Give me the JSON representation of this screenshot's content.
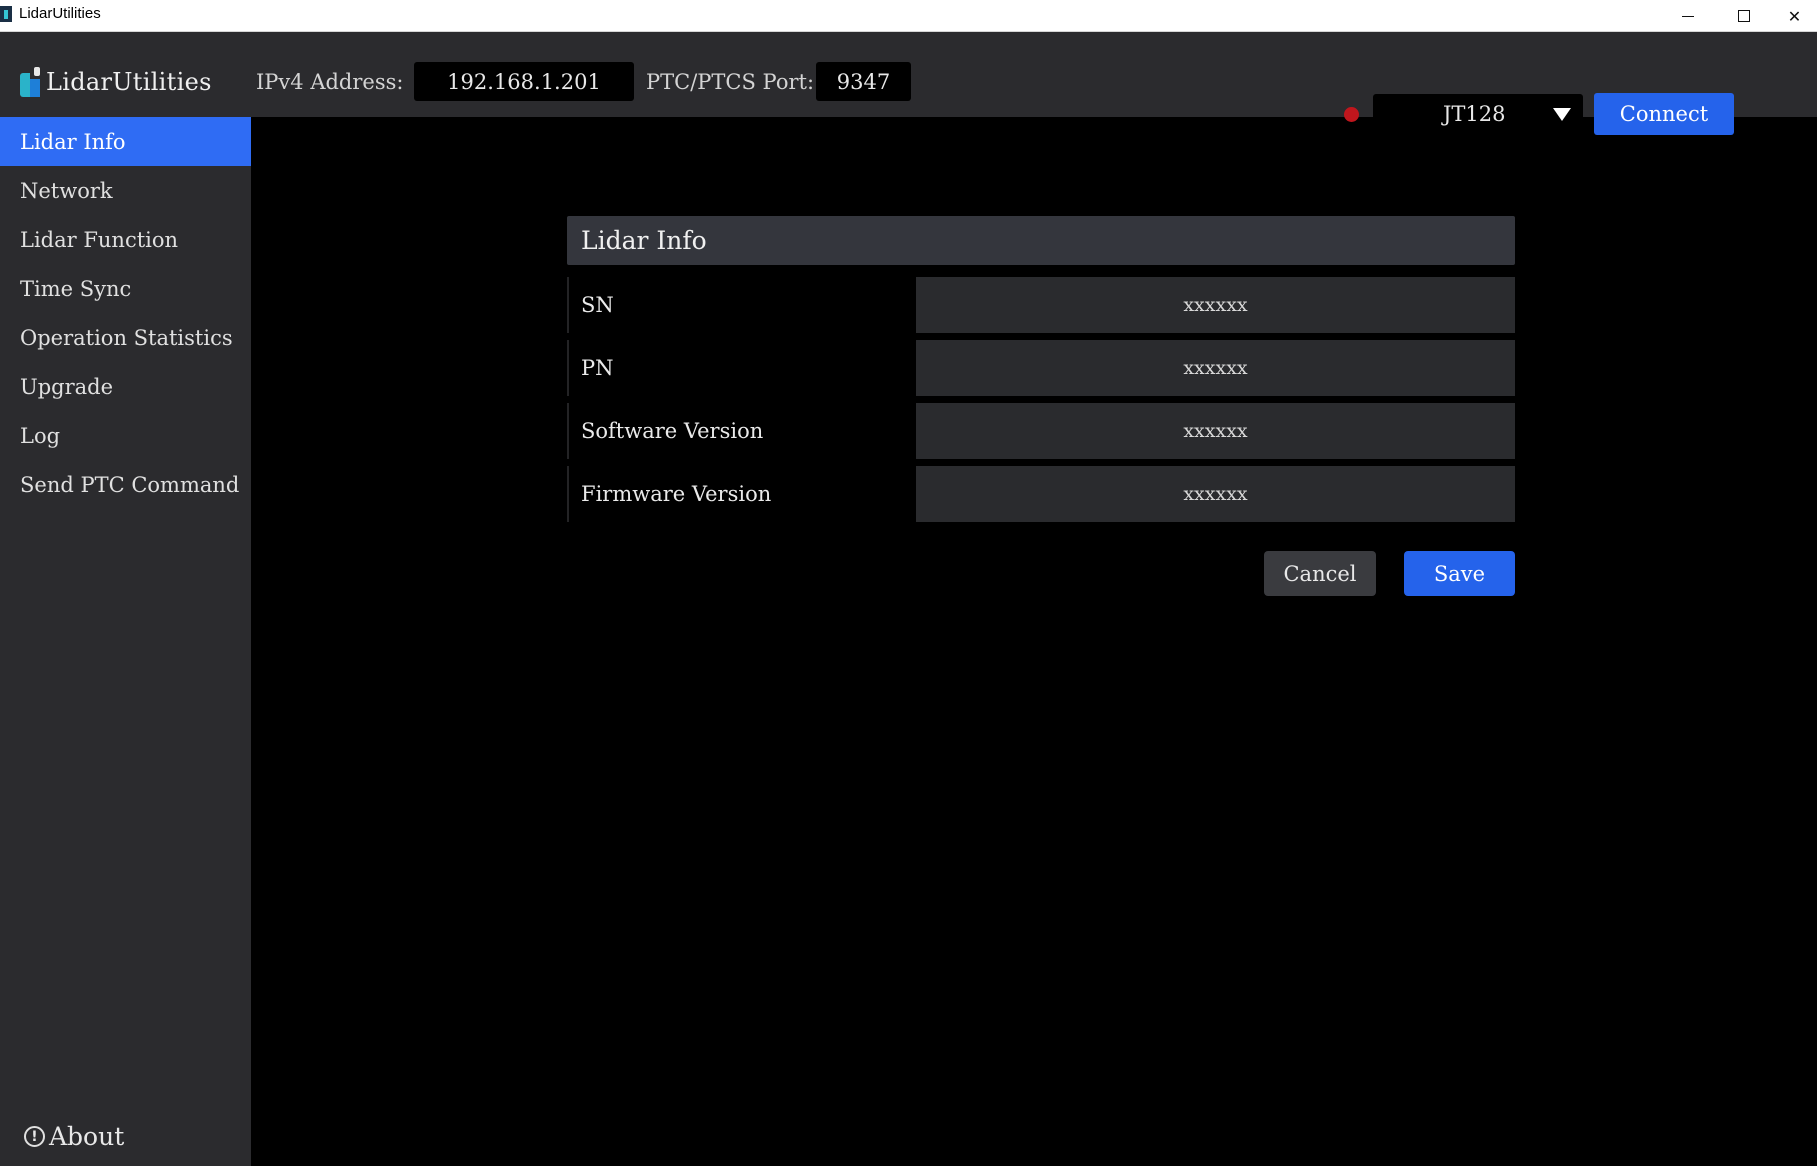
{
  "window": {
    "title": "LidarUtilities",
    "close_glyph": "✕"
  },
  "header": {
    "brand": "LidarUtilities",
    "ipv4_label": "IPv4 Address:",
    "ipv4_value": "192.168.1.201",
    "port_label": "PTC/PTCS Port:",
    "port_value": "9347",
    "connection_status_color": "#c0161d",
    "model_selected": "JT128",
    "connect_label": "Connect"
  },
  "sidebar": {
    "items": [
      {
        "label": "Lidar Info",
        "active": true
      },
      {
        "label": "Network"
      },
      {
        "label": "Lidar Function"
      },
      {
        "label": "Time Sync"
      },
      {
        "label": "Operation Statistics"
      },
      {
        "label": "Upgrade"
      },
      {
        "label": "Log"
      },
      {
        "label": "Send PTC Command"
      }
    ],
    "about_label": "About",
    "about_icon": "!"
  },
  "main": {
    "section_title": "Lidar Info",
    "rows": [
      {
        "label": "SN",
        "value": "xxxxxx"
      },
      {
        "label": "PN",
        "value": "xxxxxx"
      },
      {
        "label": "Software Version",
        "value": "xxxxxx"
      },
      {
        "label": "Firmware Version",
        "value": "xxxxxx"
      }
    ],
    "cancel_label": "Cancel",
    "save_label": "Save"
  },
  "colors": {
    "accent": "#2563eb",
    "sidebar_bg": "#2b2b2e",
    "main_bg": "#000000"
  }
}
